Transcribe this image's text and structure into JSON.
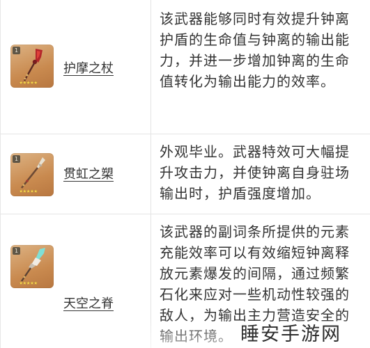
{
  "weapons": [
    {
      "rarity": "1",
      "stars": "★★★★★",
      "name": "护摩之杖",
      "icon": "red-spear-icon",
      "description": "该武器能够同时有效提升钟离护盾的生命值与钟离的输出能力，并进一步增加钟离的生命值转化为输出能力的效率。"
    },
    {
      "rarity": "1",
      "stars": "★★★★★",
      "name": "贯虹之槊",
      "icon": "jade-spear-icon",
      "description": "外观毕业。武器特效可大幅提升攻击力，并使钟离自身驻场输出时，护盾强度增加。"
    },
    {
      "rarity": "1",
      "stars": "★★★★★",
      "name": "天空之脊",
      "icon": "sky-spear-icon",
      "description": "该武器的副词条所提供的元素充能效率可以有效缩短钟离释放元素爆发的间隔，通过频繁石化来应对一些机动性较强的敌人，为输出主力营造安全的输出环境。"
    }
  ],
  "watermark": {
    "text": "睡安手游网"
  }
}
